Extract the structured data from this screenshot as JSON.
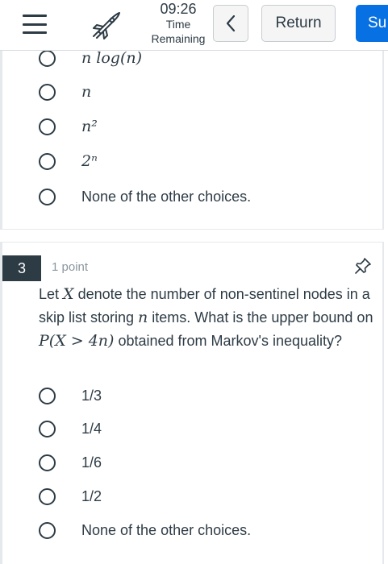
{
  "header": {
    "timer_value": "09:26",
    "timer_label_1": "Time",
    "timer_label_2": "Remaining",
    "return_label": "Return",
    "submit_label": "Su"
  },
  "prev_question": {
    "partial_option": "n log(n)",
    "options": [
      "n",
      "n²",
      "2ⁿ",
      "None of the other choices."
    ]
  },
  "question": {
    "number": "3",
    "points": "1 point",
    "text_parts": [
      "Let ",
      "X",
      " denote the number of non-sentinel nodes in a skip list storing ",
      "n",
      " items. What is the upper bound on ",
      "P(X > 4n)",
      " obtained from Markov's inequality?"
    ],
    "options": [
      "1/3",
      "1/4",
      "1/6",
      "1/2",
      "None of the other choices."
    ]
  },
  "colors": {
    "text": "#2d3b45",
    "submit_bg": "#0770e3",
    "muted": "#8b969e"
  },
  "icons": {
    "menu": "hamburger-menu-icon",
    "nav": "rocket-icon",
    "back": "chevron-left-icon",
    "pin": "pushpin-icon"
  }
}
